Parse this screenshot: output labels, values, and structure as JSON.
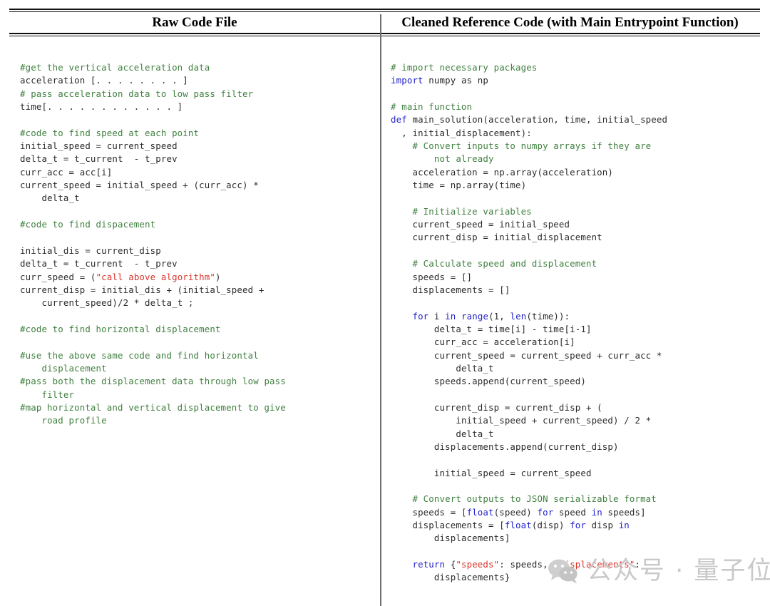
{
  "table": {
    "headers": {
      "left": "Raw Code File",
      "right": "Cleaned Reference Code (with Main Entrypoint Function)"
    }
  },
  "left_column": {
    "language": "python",
    "lines": [
      {
        "segments": [
          {
            "t": "#get the vertical acceleration data",
            "c": "cm"
          }
        ]
      },
      {
        "segments": [
          {
            "t": "acceleration [. . . . . . . . ]",
            "c": "pl"
          }
        ]
      },
      {
        "segments": [
          {
            "t": "# pass acceleration data to low pass filter",
            "c": "cm"
          }
        ]
      },
      {
        "segments": [
          {
            "t": "time[. . . . . . . . . . . . ]",
            "c": "pl"
          }
        ]
      },
      {
        "segments": [
          {
            "t": "",
            "c": "pl"
          }
        ]
      },
      {
        "segments": [
          {
            "t": "#code to find speed at each point",
            "c": "cm"
          }
        ]
      },
      {
        "segments": [
          {
            "t": "initial_speed = current_speed",
            "c": "pl"
          }
        ]
      },
      {
        "segments": [
          {
            "t": "delta_t = t_current  - t_prev",
            "c": "pl"
          }
        ]
      },
      {
        "segments": [
          {
            "t": "curr_acc = acc[i]",
            "c": "pl"
          }
        ]
      },
      {
        "segments": [
          {
            "t": "current_speed = initial_speed + (curr_acc) *",
            "c": "pl"
          }
        ]
      },
      {
        "segments": [
          {
            "t": "    delta_t",
            "c": "pl"
          }
        ]
      },
      {
        "segments": [
          {
            "t": "",
            "c": "pl"
          }
        ]
      },
      {
        "segments": [
          {
            "t": "#code to find dispacement",
            "c": "cm"
          }
        ]
      },
      {
        "segments": [
          {
            "t": "",
            "c": "pl"
          }
        ]
      },
      {
        "segments": [
          {
            "t": "initial_dis = current_disp",
            "c": "pl"
          }
        ]
      },
      {
        "segments": [
          {
            "t": "delta_t = t_current  - t_prev",
            "c": "pl"
          }
        ]
      },
      {
        "segments": [
          {
            "t": "curr_speed = (",
            "c": "pl"
          },
          {
            "t": "\"call above algorithm\"",
            "c": "st"
          },
          {
            "t": ")",
            "c": "pl"
          }
        ]
      },
      {
        "segments": [
          {
            "t": "current_disp = initial_dis + (initial_speed +",
            "c": "pl"
          }
        ]
      },
      {
        "segments": [
          {
            "t": "    current_speed)/2 * delta_t ;",
            "c": "pl"
          }
        ]
      },
      {
        "segments": [
          {
            "t": "",
            "c": "pl"
          }
        ]
      },
      {
        "segments": [
          {
            "t": "#code to find horizontal displacement",
            "c": "cm"
          }
        ]
      },
      {
        "segments": [
          {
            "t": "",
            "c": "pl"
          }
        ]
      },
      {
        "segments": [
          {
            "t": "#use the above same code and find horizontal",
            "c": "cm"
          }
        ]
      },
      {
        "segments": [
          {
            "t": "    displacement",
            "c": "cm"
          }
        ]
      },
      {
        "segments": [
          {
            "t": "#pass both the displacement data through low pass",
            "c": "cm"
          }
        ]
      },
      {
        "segments": [
          {
            "t": "    filter",
            "c": "cm"
          }
        ]
      },
      {
        "segments": [
          {
            "t": "#map horizontal and vertical displacement to give",
            "c": "cm"
          }
        ]
      },
      {
        "segments": [
          {
            "t": "    road profile",
            "c": "cm"
          }
        ]
      }
    ]
  },
  "right_column": {
    "language": "python",
    "lines": [
      {
        "segments": [
          {
            "t": "# import necessary packages",
            "c": "cm"
          }
        ]
      },
      {
        "segments": [
          {
            "t": "import",
            "c": "kw"
          },
          {
            "t": " numpy as np",
            "c": "pl"
          }
        ]
      },
      {
        "segments": [
          {
            "t": "",
            "c": "pl"
          }
        ]
      },
      {
        "segments": [
          {
            "t": "# main function",
            "c": "cm"
          }
        ]
      },
      {
        "segments": [
          {
            "t": "def",
            "c": "kw"
          },
          {
            "t": " main_solution(acceleration, time, initial_speed",
            "c": "pl"
          }
        ]
      },
      {
        "segments": [
          {
            "t": "  , initial_displacement):",
            "c": "pl"
          }
        ]
      },
      {
        "segments": [
          {
            "t": "    # Convert inputs to numpy arrays if they are",
            "c": "cm"
          }
        ]
      },
      {
        "segments": [
          {
            "t": "        not already",
            "c": "cm"
          }
        ]
      },
      {
        "segments": [
          {
            "t": "    acceleration = np.array(acceleration)",
            "c": "pl"
          }
        ]
      },
      {
        "segments": [
          {
            "t": "    time = np.array(time)",
            "c": "pl"
          }
        ]
      },
      {
        "segments": [
          {
            "t": "",
            "c": "pl"
          }
        ]
      },
      {
        "segments": [
          {
            "t": "    # Initialize variables",
            "c": "cm"
          }
        ]
      },
      {
        "segments": [
          {
            "t": "    current_speed = initial_speed",
            "c": "pl"
          }
        ]
      },
      {
        "segments": [
          {
            "t": "    current_disp = initial_displacement",
            "c": "pl"
          }
        ]
      },
      {
        "segments": [
          {
            "t": "",
            "c": "pl"
          }
        ]
      },
      {
        "segments": [
          {
            "t": "    # Calculate speed and displacement",
            "c": "cm"
          }
        ]
      },
      {
        "segments": [
          {
            "t": "    speeds = []",
            "c": "pl"
          }
        ]
      },
      {
        "segments": [
          {
            "t": "    displacements = []",
            "c": "pl"
          }
        ]
      },
      {
        "segments": [
          {
            "t": "",
            "c": "pl"
          }
        ]
      },
      {
        "segments": [
          {
            "t": "    ",
            "c": "pl"
          },
          {
            "t": "for",
            "c": "kw"
          },
          {
            "t": " i ",
            "c": "pl"
          },
          {
            "t": "in",
            "c": "kw"
          },
          {
            "t": " ",
            "c": "pl"
          },
          {
            "t": "range",
            "c": "kw"
          },
          {
            "t": "(1, ",
            "c": "pl"
          },
          {
            "t": "len",
            "c": "kw"
          },
          {
            "t": "(time)):",
            "c": "pl"
          }
        ]
      },
      {
        "segments": [
          {
            "t": "        delta_t = time[i] - time[i-1]",
            "c": "pl"
          }
        ]
      },
      {
        "segments": [
          {
            "t": "        curr_acc = acceleration[i]",
            "c": "pl"
          }
        ]
      },
      {
        "segments": [
          {
            "t": "        current_speed = current_speed + curr_acc *",
            "c": "pl"
          }
        ]
      },
      {
        "segments": [
          {
            "t": "            delta_t",
            "c": "pl"
          }
        ]
      },
      {
        "segments": [
          {
            "t": "        speeds.append(current_speed)",
            "c": "pl"
          }
        ]
      },
      {
        "segments": [
          {
            "t": "",
            "c": "pl"
          }
        ]
      },
      {
        "segments": [
          {
            "t": "        current_disp = current_disp + (",
            "c": "pl"
          }
        ]
      },
      {
        "segments": [
          {
            "t": "            initial_speed + current_speed) / 2 *",
            "c": "pl"
          }
        ]
      },
      {
        "segments": [
          {
            "t": "            delta_t",
            "c": "pl"
          }
        ]
      },
      {
        "segments": [
          {
            "t": "        displacements.append(current_disp)",
            "c": "pl"
          }
        ]
      },
      {
        "segments": [
          {
            "t": "",
            "c": "pl"
          }
        ]
      },
      {
        "segments": [
          {
            "t": "        initial_speed = current_speed",
            "c": "pl"
          }
        ]
      },
      {
        "segments": [
          {
            "t": "",
            "c": "pl"
          }
        ]
      },
      {
        "segments": [
          {
            "t": "    # Convert outputs to JSON serializable format",
            "c": "cm"
          }
        ]
      },
      {
        "segments": [
          {
            "t": "    speeds = [",
            "c": "pl"
          },
          {
            "t": "float",
            "c": "kw"
          },
          {
            "t": "(speed) ",
            "c": "pl"
          },
          {
            "t": "for",
            "c": "kw"
          },
          {
            "t": " speed ",
            "c": "pl"
          },
          {
            "t": "in",
            "c": "kw"
          },
          {
            "t": " speeds]",
            "c": "pl"
          }
        ]
      },
      {
        "segments": [
          {
            "t": "    displacements = [",
            "c": "pl"
          },
          {
            "t": "float",
            "c": "kw"
          },
          {
            "t": "(disp) ",
            "c": "pl"
          },
          {
            "t": "for",
            "c": "kw"
          },
          {
            "t": " disp ",
            "c": "pl"
          },
          {
            "t": "in",
            "c": "kw"
          }
        ]
      },
      {
        "segments": [
          {
            "t": "        displacements]",
            "c": "pl"
          }
        ]
      },
      {
        "segments": [
          {
            "t": "",
            "c": "pl"
          }
        ]
      },
      {
        "segments": [
          {
            "t": "    ",
            "c": "pl"
          },
          {
            "t": "return",
            "c": "kw"
          },
          {
            "t": " {",
            "c": "pl"
          },
          {
            "t": "\"speeds\"",
            "c": "st"
          },
          {
            "t": ": speeds, ",
            "c": "pl"
          },
          {
            "t": "\"displacements\"",
            "c": "st"
          },
          {
            "t": ":",
            "c": "pl"
          }
        ]
      },
      {
        "segments": [
          {
            "t": "        displacements}",
            "c": "pl"
          }
        ]
      }
    ]
  },
  "watermark": {
    "text": "公众号 · 量子位",
    "logo": "wechat-icon",
    "color": "#c9c9c9"
  },
  "colors": {
    "comment": "#408040",
    "keyword": "#2222cc",
    "string": "#d9342b",
    "plain": "#2b2b2b",
    "rule": "#111111",
    "divider": "#6e6e6e",
    "background": "#ffffff"
  }
}
